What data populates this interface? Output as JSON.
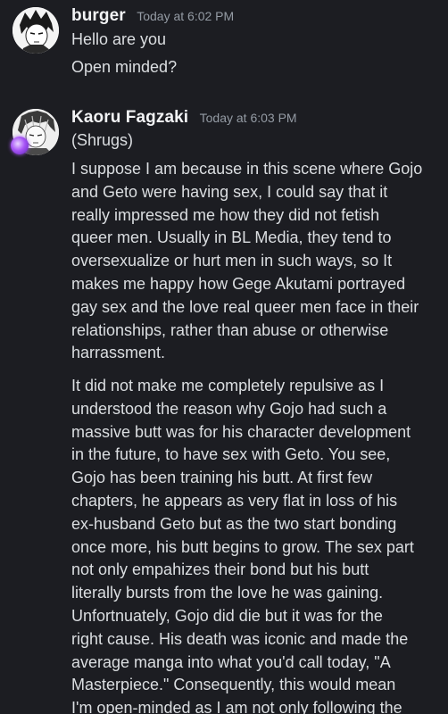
{
  "messages": [
    {
      "username": "burger",
      "timestamp": "Today at 6:02 PM",
      "avatar_icon": "manga-avatar-icon",
      "lines": [
        "Hello are you",
        "Open minded?"
      ]
    },
    {
      "username": "Kaoru Fagzaki",
      "timestamp": "Today at 6:03 PM",
      "avatar_icon": "manga-avatar-icon",
      "badge_icon": "purple-orb-badge-icon",
      "lines": [
        "(Shrugs)",
        "I suppose I am because in this scene where Gojo\nand Geto were having sex, I could say that it\nreally impressed me how they did not fetish\nqueer men. Usually in BL Media, they tend to\noversexualize or hurt men in such ways, so It\nmakes me happy how Gege Akutami portrayed\ngay sex and the love real queer men face in their\nrelationships, rather than abuse or otherwise\nharrassment.",
        "It did not make me completely repulsive as I\nunderstood the reason why Gojo had such a\nmassive butt was for his character development\nin the future, to have sex with Geto. You see,\nGojo has been training his butt. At first few\nchapters, he appears as very flat in loss of his\nex-husband Geto but as the two start bonding\nonce more, his butt begins to grow. The sex part\nnot only empahizes their bond but his butt\nliterally bursts from the love he was gaining.\nUnfortnuately, Gojo did die but it was for the\nright cause. His death was iconic and made the\naverage manga into what you'd call today, \"A\nMasterpiece.\" Consequently, this would mean\nI'm open-minded as I am not only following the"
      ]
    }
  ]
}
